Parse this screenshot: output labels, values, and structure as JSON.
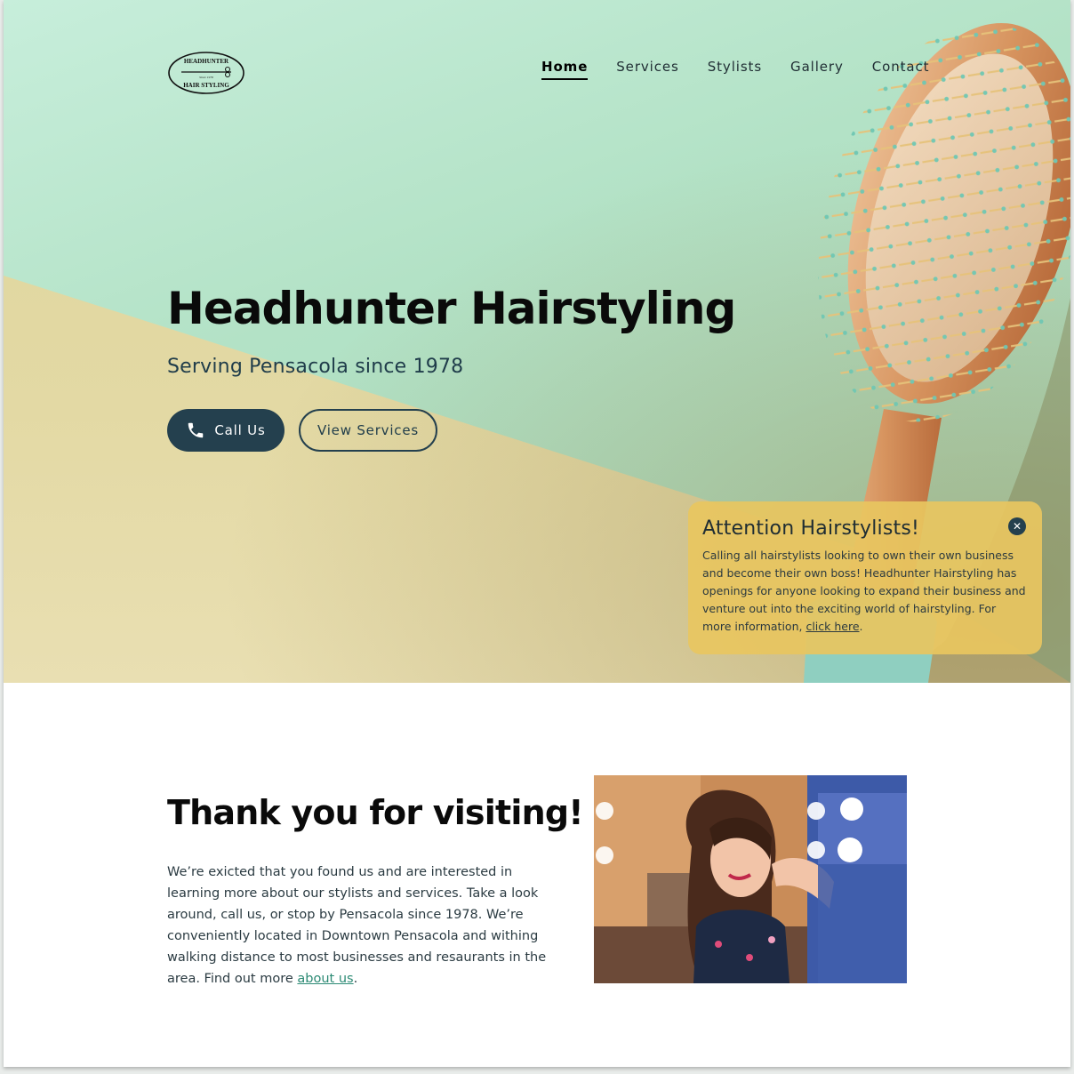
{
  "brand": {
    "logo_top": "HEADHUNTER",
    "logo_mid": "Since 1978",
    "logo_bottom": "HAIR STYLING"
  },
  "nav": {
    "items": [
      {
        "label": "Home",
        "active": true
      },
      {
        "label": "Services",
        "active": false
      },
      {
        "label": "Stylists",
        "active": false
      },
      {
        "label": "Gallery",
        "active": false
      },
      {
        "label": "Contact",
        "active": false
      }
    ]
  },
  "hero": {
    "title": "Headhunter Hairstyling",
    "subtitle": "Serving Pensacola since 1978",
    "call_label": "Call Us",
    "view_label": "View Services"
  },
  "notice": {
    "title": "Attention Hairstylists!",
    "body": "Calling all hairstylists looking to own their own business and become their own boss! Headhunter Hairstyling has openings for anyone looking to expand their business and venture out into the exciting world of hairstyling. For more information, ",
    "link": "click here",
    "end": ".",
    "close_symbol": "✕"
  },
  "intro": {
    "title": "Thank you for visiting!",
    "body": "We’re exicted that you found us and are interested in learning more about our stylists and services. Take a look around, call us, or stop by Pensacola since 1978. We’re conveniently located in Downtown Pensacola and withing walking distance to most businesses and resaurants in the area. Find out more ",
    "link": "about us",
    "end": "."
  },
  "colors": {
    "primary": "#24404e",
    "mint": "#b3e2c6",
    "sand": "#e3d9a4",
    "notice": "#e8c660",
    "link": "#2c8a74"
  },
  "icons": {
    "phone": "phone-icon",
    "close": "close-icon"
  }
}
